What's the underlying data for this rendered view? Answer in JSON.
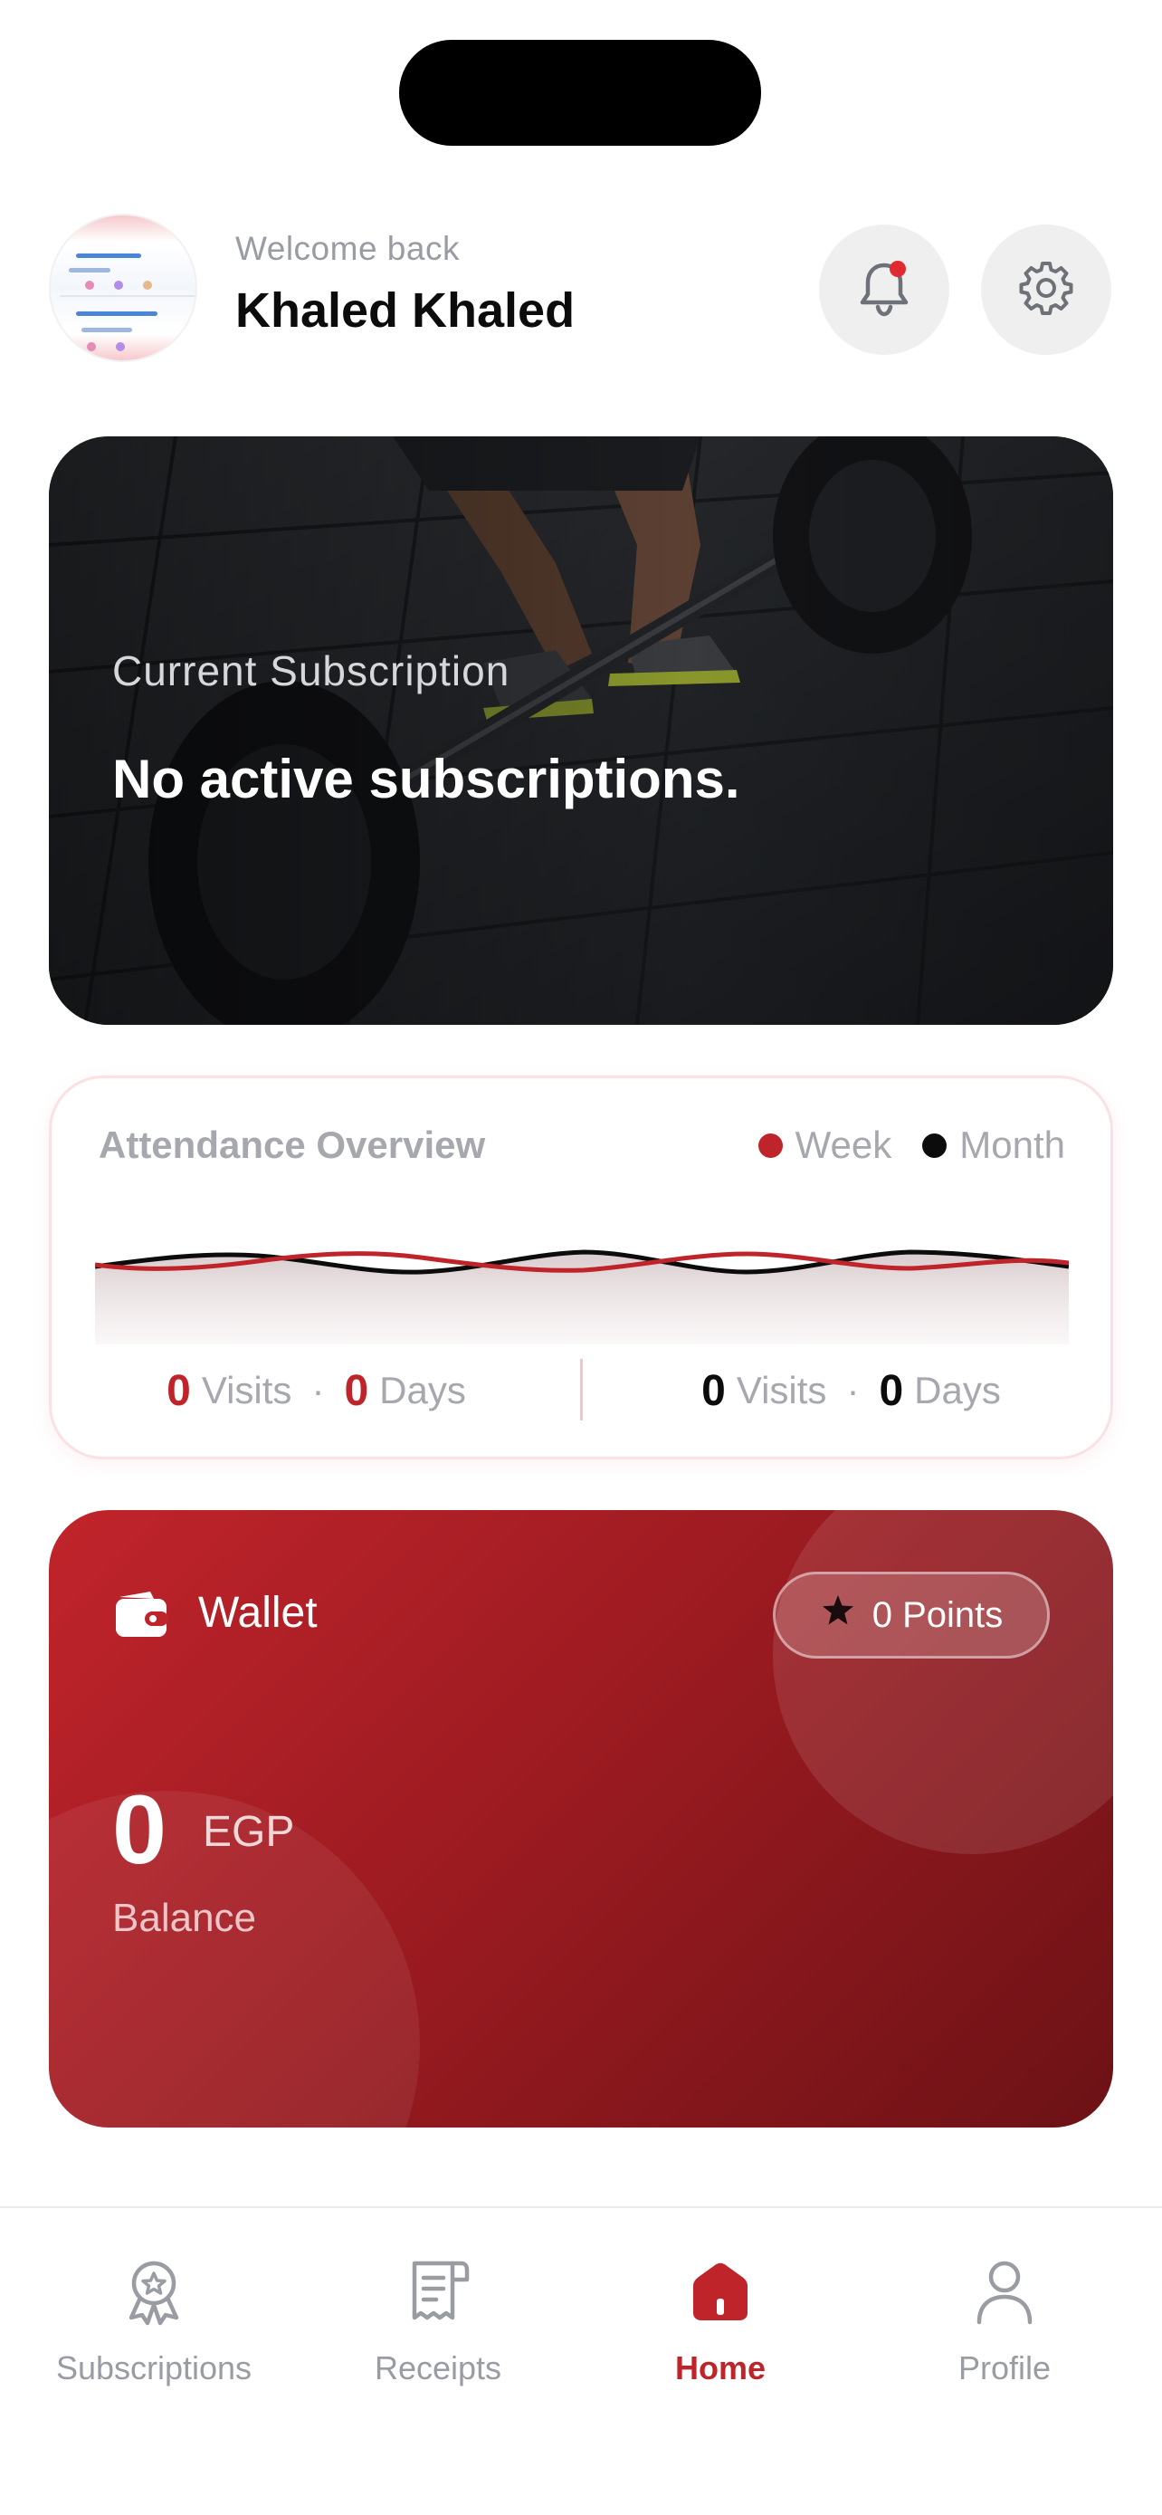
{
  "header": {
    "welcome": "Welcome back",
    "user_name": "Khaled Khaled"
  },
  "subscription": {
    "label": "Current Subscription",
    "value": "No active subscriptions."
  },
  "attendance": {
    "title": "Attendance Overview",
    "legend": {
      "week": "Week",
      "month": "Month"
    },
    "week": {
      "visits": "0",
      "visits_label": "Visits",
      "days": "0",
      "days_label": "Days",
      "separator": "·"
    },
    "month": {
      "visits": "0",
      "visits_label": "Visits",
      "days": "0",
      "days_label": "Days",
      "separator": "·"
    }
  },
  "wallet": {
    "title": "Wallet",
    "points": "0 Points",
    "amount": "0",
    "currency": "EGP",
    "balance_label": "Balance"
  },
  "nav": {
    "items": [
      {
        "label": "Subscriptions",
        "icon": "award-icon",
        "active": false
      },
      {
        "label": "Receipts",
        "icon": "receipt-icon",
        "active": false
      },
      {
        "label": "Home",
        "icon": "home-icon",
        "active": true
      },
      {
        "label": "Profile",
        "icon": "user-icon",
        "active": false
      }
    ]
  },
  "colors": {
    "accent": "#c0242b",
    "week_series": "#c0242b",
    "month_series": "#0c0c0c",
    "muted_text": "#9a9ca3"
  }
}
